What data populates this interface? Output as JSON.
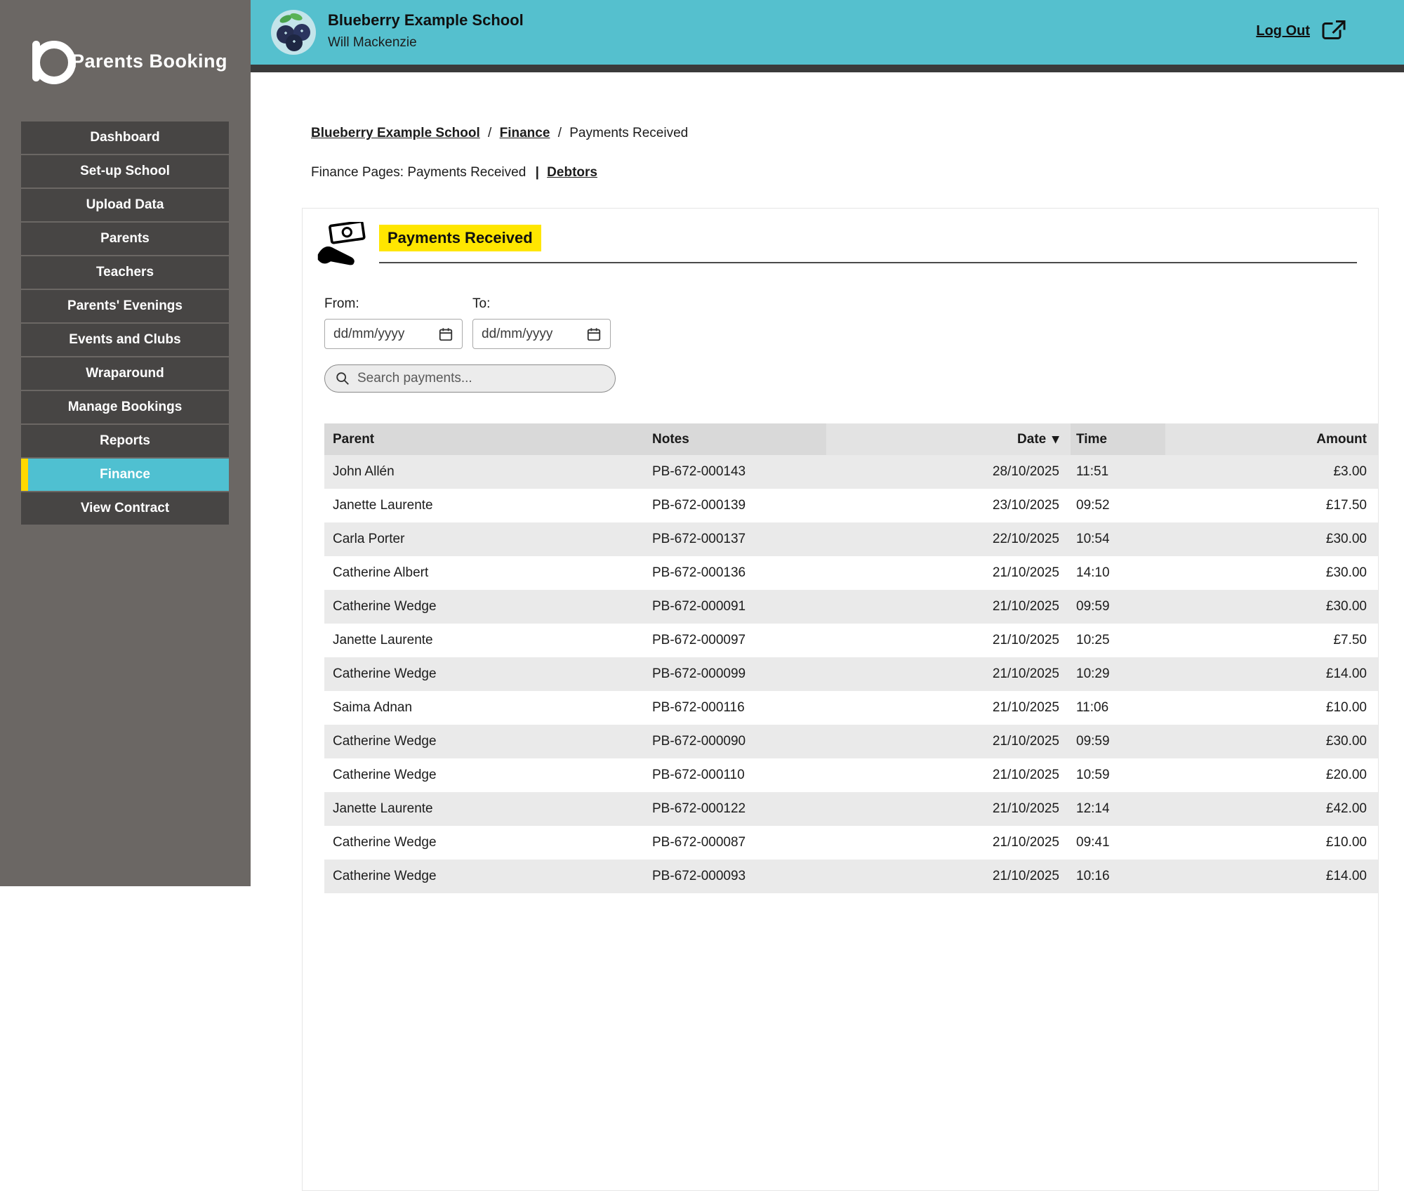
{
  "brand": {
    "name": "Parents Booking"
  },
  "sidebar": {
    "items": [
      {
        "label": "Dashboard",
        "active": false
      },
      {
        "label": "Set-up School",
        "active": false
      },
      {
        "label": "Upload Data",
        "active": false
      },
      {
        "label": "Parents",
        "active": false
      },
      {
        "label": "Teachers",
        "active": false
      },
      {
        "label": "Parents' Evenings",
        "active": false
      },
      {
        "label": "Events and Clubs",
        "active": false
      },
      {
        "label": "Wraparound",
        "active": false
      },
      {
        "label": "Manage Bookings",
        "active": false
      },
      {
        "label": "Reports",
        "active": false
      },
      {
        "label": "Finance",
        "active": true
      },
      {
        "label": "View Contract",
        "active": false
      }
    ]
  },
  "header": {
    "school_name": "Blueberry Example School",
    "user_name": "Will Mackenzie",
    "logout_label": "Log Out"
  },
  "breadcrumb": {
    "separator": "/",
    "items": [
      {
        "label": "Blueberry Example School"
      },
      {
        "label": "Finance"
      },
      {
        "label": "Payments Received"
      }
    ]
  },
  "finance_nav": {
    "label": "Finance Pages:",
    "current": "Payments Received",
    "divider": "|",
    "debtors_label": "Debtors"
  },
  "panel": {
    "title": "Payments Received"
  },
  "filters": {
    "from_label": "From:",
    "to_label": "To:",
    "date_placeholder": "dd/mm/yyyy",
    "search_placeholder": "Search payments..."
  },
  "table": {
    "headers": {
      "parent": "Parent",
      "notes": "Notes",
      "date": "Date",
      "time": "Time",
      "amount": "Amount"
    },
    "sort_indicator": "▼",
    "rows": [
      [
        "John Allén",
        "PB-672-000143",
        "28/10/2025",
        "11:51",
        "£3.00"
      ],
      [
        "Janette Laurente",
        "PB-672-000139",
        "23/10/2025",
        "09:52",
        "£17.50"
      ],
      [
        "Carla Porter",
        "PB-672-000137",
        "22/10/2025",
        "10:54",
        "£30.00"
      ],
      [
        "Catherine Albert",
        "PB-672-000136",
        "21/10/2025",
        "14:10",
        "£30.00"
      ],
      [
        "Catherine Wedge",
        "PB-672-000091",
        "21/10/2025",
        "09:59",
        "£30.00"
      ],
      [
        "Janette Laurente",
        "PB-672-000097",
        "21/10/2025",
        "10:25",
        "£7.50"
      ],
      [
        "Catherine Wedge",
        "PB-672-000099",
        "21/10/2025",
        "10:29",
        "£14.00"
      ],
      [
        "Saima Adnan",
        "PB-672-000116",
        "21/10/2025",
        "11:06",
        "£10.00"
      ],
      [
        "Catherine Wedge",
        "PB-672-000090",
        "21/10/2025",
        "09:59",
        "£30.00"
      ],
      [
        "Catherine Wedge",
        "PB-672-000110",
        "21/10/2025",
        "10:59",
        "£20.00"
      ],
      [
        "Janette Laurente",
        "PB-672-000122",
        "21/10/2025",
        "12:14",
        "£42.00"
      ],
      [
        "Catherine Wedge",
        "PB-672-000087",
        "21/10/2025",
        "09:41",
        "£10.00"
      ],
      [
        "Catherine Wedge",
        "PB-672-000093",
        "21/10/2025",
        "10:16",
        "£14.00"
      ]
    ]
  },
  "colors": {
    "teal": "#55c0ce",
    "yellow_bar": "#ffd900",
    "yellow_highlight": "#ffe600",
    "sidebar_bg": "#6b6764",
    "sidebar_item_bg": "#474544",
    "dark_strip": "#3a3a3a"
  }
}
